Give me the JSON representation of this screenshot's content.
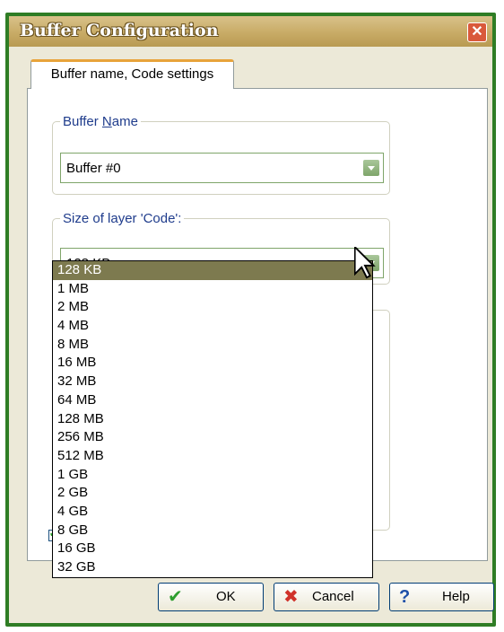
{
  "window": {
    "title": "Buffer Configuration",
    "close_glyph": "✕"
  },
  "tabs": [
    {
      "label": "Buffer name, Code settings"
    }
  ],
  "buffer_name": {
    "legend_pre": "Buffer ",
    "legend_u": "N",
    "legend_post": "ame",
    "value": "Buffer #0"
  },
  "code_size": {
    "legend": "Size of layer 'Code':",
    "value": "128 KB",
    "options": [
      "128 KB",
      "1 MB",
      "2 MB",
      "4 MB",
      "8 MB",
      "16 MB",
      "32 MB",
      "64 MB",
      "128 MB",
      "256 MB",
      "512 MB",
      "1 GB",
      "2 GB",
      "4 GB",
      "8 GB",
      "16 GB",
      "32 GB"
    ],
    "selected_index": 0
  },
  "buttons": {
    "ok": "OK",
    "cancel": "Cancel",
    "help": "Help"
  },
  "icons": {
    "ok": "checkmark-icon",
    "cancel": "x-icon",
    "help": "question-icon"
  },
  "colors": {
    "frame": "#2f7d25",
    "title_bar": "#c8ab66",
    "selected": "#7d7a4f"
  }
}
